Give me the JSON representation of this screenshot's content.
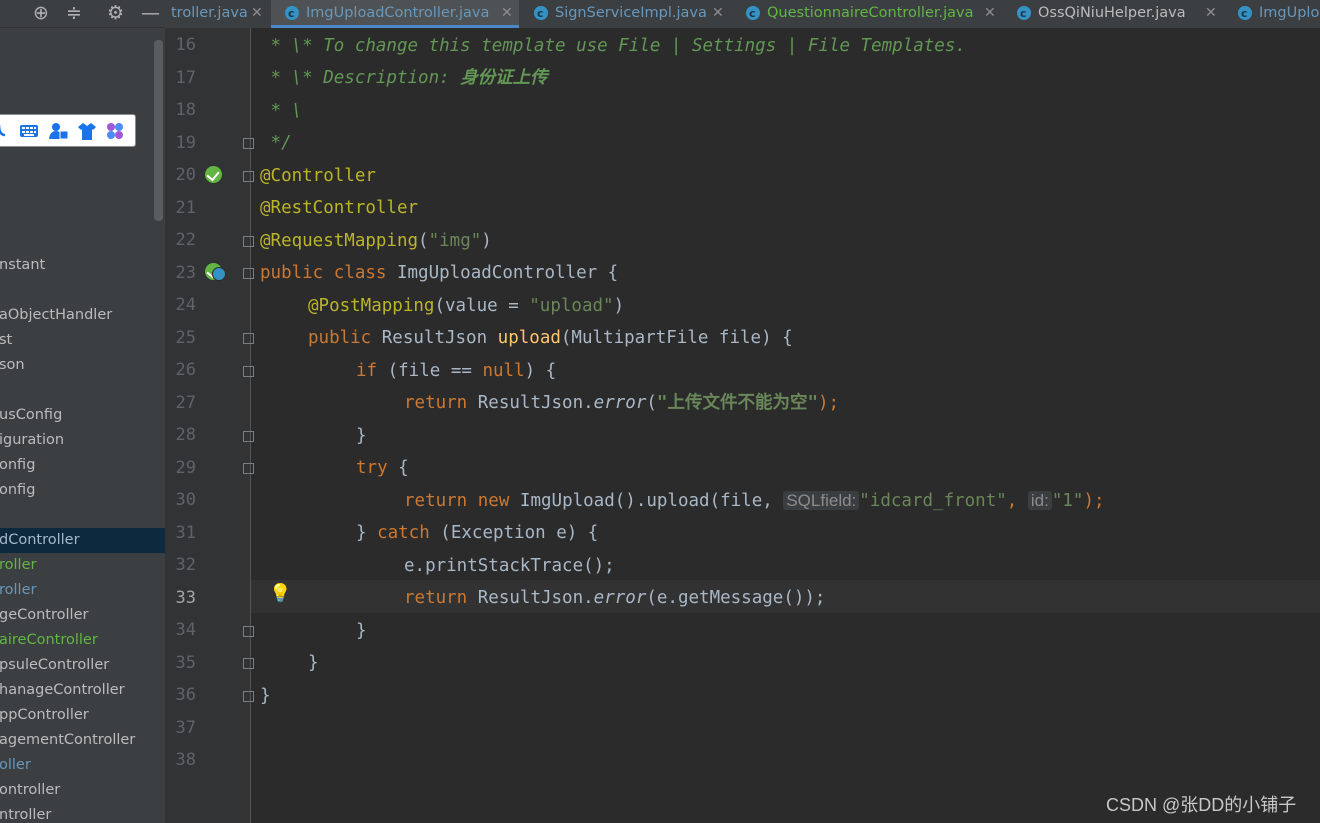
{
  "sidebar": {
    "toolbar": [
      "target-icon",
      "collapse-icon",
      "gear-icon",
      "minimize-icon"
    ],
    "items": [
      {
        "label": "nstant",
        "state": "normal"
      },
      {
        "label": "aObjectHandler",
        "state": "normal"
      },
      {
        "label": "st",
        "state": "normal"
      },
      {
        "label": "son",
        "state": "normal"
      },
      {
        "label": "usConfig",
        "state": "normal"
      },
      {
        "label": "iguration",
        "state": "normal"
      },
      {
        "label": "onfig",
        "state": "normal"
      },
      {
        "label": "onfig",
        "state": "normal"
      },
      {
        "label": "dController",
        "state": "selected"
      },
      {
        "label": "roller",
        "state": "green"
      },
      {
        "label": "roller",
        "state": "blue"
      },
      {
        "label": "geController",
        "state": "normal"
      },
      {
        "label": "aireController",
        "state": "green"
      },
      {
        "label": "psuleController",
        "state": "normal"
      },
      {
        "label": "hanageController",
        "state": "normal"
      },
      {
        "label": "ppController",
        "state": "normal"
      },
      {
        "label": "agementController",
        "state": "normal"
      },
      {
        "label": "oller",
        "state": "blue"
      },
      {
        "label": "ontroller",
        "state": "normal"
      },
      {
        "label": "ntroller",
        "state": "normal"
      }
    ]
  },
  "tabs": [
    {
      "label": "troller.java",
      "color": "#6897bb",
      "active": false,
      "icon": false
    },
    {
      "label": "ImgUploadController.java",
      "color": "#6897bb",
      "active": true,
      "icon": true
    },
    {
      "label": "SignServiceImpl.java",
      "color": "#6897bb",
      "active": false,
      "icon": true
    },
    {
      "label": "QuestionnaireController.java",
      "color": "#62b543",
      "active": false,
      "icon": true
    },
    {
      "label": "OssQiNiuHelper.java",
      "color": "#bbbbbb",
      "active": false,
      "icon": true
    },
    {
      "label": "ImgUploa",
      "color": "#6897bb",
      "active": false,
      "icon": true
    }
  ],
  "editor": {
    "line_numbers": [
      "16",
      "17",
      "18",
      "19",
      "20",
      "21",
      "22",
      "23",
      "24",
      "25",
      "26",
      "27",
      "28",
      "29",
      "30",
      "31",
      "32",
      "33",
      "34",
      "35",
      "36",
      "37",
      "38"
    ],
    "current_line": "33",
    "lines": {
      "l16": " * \\* To change this template use File | Settings | File Templates.",
      "l17_prefix": " * \\* Description: ",
      "l17_cn": "身份证上传",
      "l18": " * \\",
      "l19": " */",
      "l20": "@Controller",
      "l21": "@RestController",
      "l22_ann": "@RequestMapping",
      "l22_open": "(",
      "l22_str": "\"img\"",
      "l22_close": ")",
      "l23_kw": "public class ",
      "l23_rest": "ImgUploadController {",
      "l24_ann": "@PostMapping",
      "l24_mid": "(value = ",
      "l24_str": "\"upload\"",
      "l24_close": ")",
      "l25_kw": "public ",
      "l25_type": "ResultJson ",
      "l25_fn": "upload",
      "l25_rest": "(MultipartFile file) {",
      "l26_kw": "if ",
      "l26_mid": "(file == ",
      "l26_null": "null",
      "l26_rest": ") {",
      "l27_kw": "return ",
      "l27_mid": "ResultJson.",
      "l27_call": "error",
      "l27_open": "(",
      "l27_str": "\"上传文件不能为空\"",
      "l27_close": ");",
      "l28": "}",
      "l29_kw": "try ",
      "l29_rest": "{",
      "l30_kw1": "return ",
      "l30_kw2": "new ",
      "l30_mid": "ImgUpload().upload(file,",
      "l30_hint1": "SQLfield:",
      "l30_str1": "\"idcard_front\"",
      "l30_comma": ",",
      "l30_hint2": "id:",
      "l30_str2": "\"1\"",
      "l30_close": ");",
      "l31_open": "} ",
      "l31_kw": "catch ",
      "l31_rest": "(Exception e) {",
      "l32": "e.printStackTrace();",
      "l33_kw": "return ",
      "l33_mid": "ResultJson.",
      "l33_call": "error",
      "l33_rest": "(e.getMessage());",
      "l34": "}",
      "l35": "}",
      "l36": "}"
    }
  },
  "watermark": "CSDN @张DD的小铺子"
}
